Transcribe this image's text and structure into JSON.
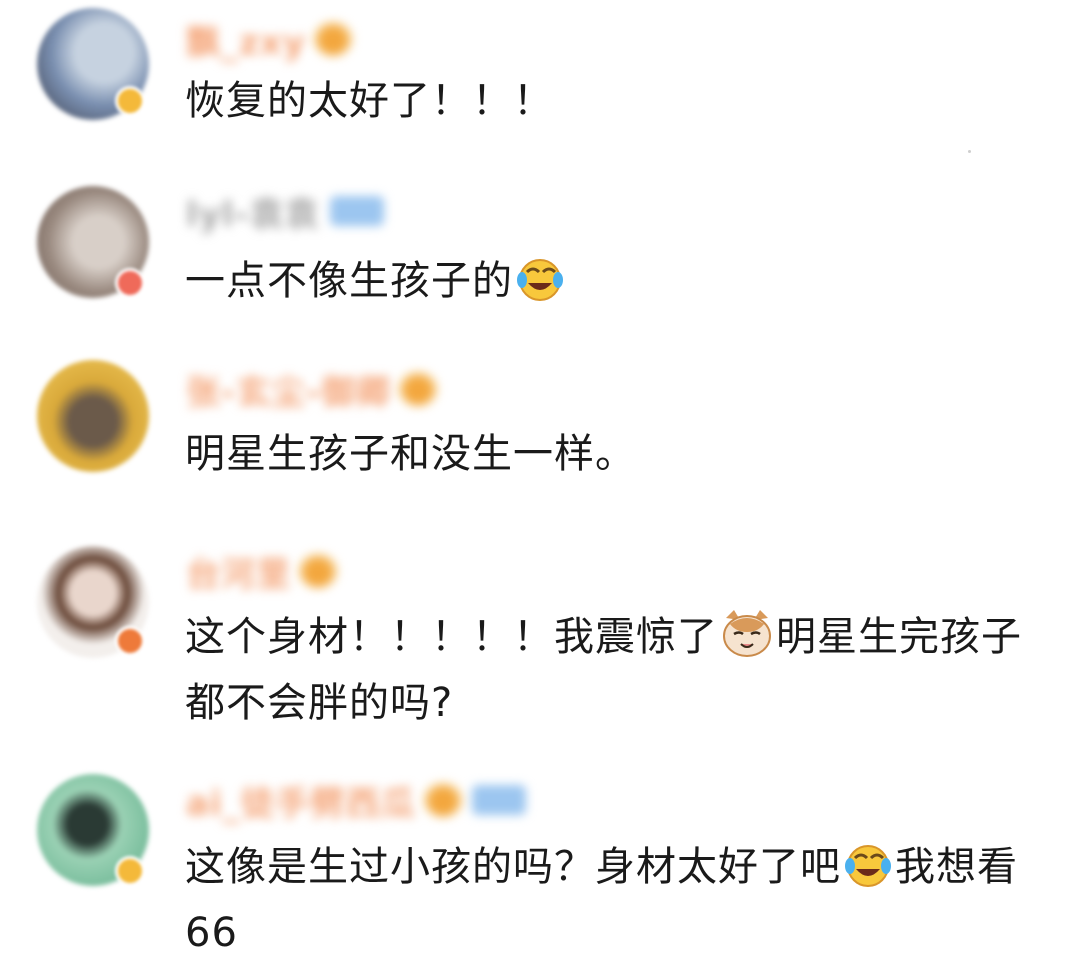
{
  "comments": [
    {
      "username": "飘_zxy",
      "text_segments": [
        "恢复的太好了！！！"
      ],
      "has_crown": true,
      "has_vip_tag": false,
      "username_color": "#f5a67a",
      "avatar_colors": [
        "#7a8fb0",
        "#c6d2e0",
        "#3a3d4a"
      ],
      "badge_color": "#f4b93a"
    },
    {
      "username": "lyl-袁袁",
      "text_segments": [
        "一点不像生孩子的"
      ],
      "emoji_after": "laugh-cry-emoji",
      "has_crown": false,
      "has_vip_tag": true,
      "username_color": "#a8a8a8",
      "avatar_colors": [
        "#9a8a80",
        "#d8cfc8",
        "#6b5a52"
      ],
      "badge_color": "#ef6a5a"
    },
    {
      "username": "张-玄尘-御卿",
      "text_segments": [
        "明星生孩子和没生一样。"
      ],
      "has_crown": true,
      "has_vip_tag": false,
      "username_color": "#f5a67a",
      "avatar_colors": [
        "#d9a93a",
        "#f0c85a",
        "#4a3a2a"
      ],
      "badge_color": null
    },
    {
      "username": "台河里",
      "text_segments": [
        "这个身材！！！！！我震惊了",
        "明星生完孩子都不会胖的吗?"
      ],
      "emoji_inline": "cat-face-emoji",
      "has_crown": true,
      "has_vip_tag": false,
      "username_color": "#f5a67a",
      "avatar_colors": [
        "#f3efec",
        "#e9d6cc",
        "#6b4a3a"
      ],
      "badge_color": "#ee7a3a"
    },
    {
      "username": "ai_徒手劈西瓜",
      "text_segments": [
        "这像是生过小孩的吗？身材太好了吧",
        "我想看66"
      ],
      "emoji_inline": "laugh-cry-emoji",
      "has_crown": true,
      "has_vip_tag": true,
      "username_color": "#f5a67a",
      "avatar_colors": [
        "#5fae8a",
        "#9ad1b4",
        "#2a3a34"
      ],
      "badge_color": "#f4b93a"
    }
  ]
}
